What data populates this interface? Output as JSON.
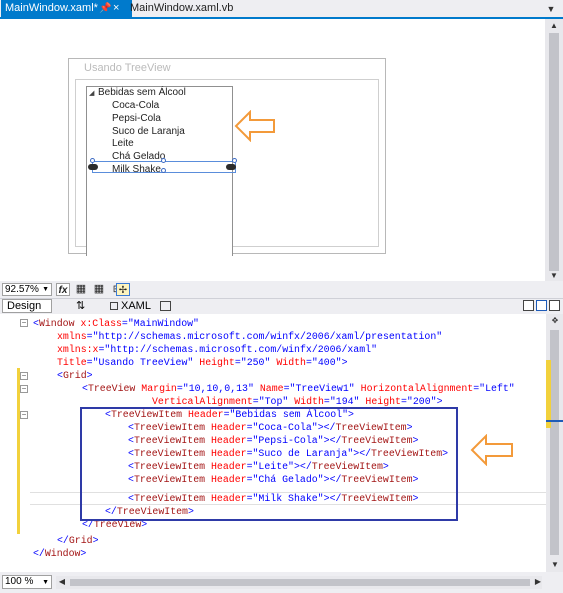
{
  "tabs": [
    {
      "label": "MainWindow.xaml*",
      "active": true
    },
    {
      "label": "MainWindow.xaml.vb",
      "active": false
    }
  ],
  "icons": {
    "pin": "📌",
    "close": "×",
    "dropdown": "▼",
    "fx": "fx",
    "swap": "⇅"
  },
  "designer": {
    "window_title": "Usando TreeView",
    "tree": {
      "root": "Bebidas sem Álcool",
      "expander": "◢",
      "items": [
        "Coca-Cola",
        "Pepsi-Cola",
        "Suco de Laranja",
        "Leite",
        "Chá Gelado",
        "Milk Shake"
      ]
    },
    "zoom": "92.57%"
  },
  "split": {
    "design_label": "Design",
    "xaml_label": "XAML"
  },
  "code": {
    "lines": [
      "<Window x:Class=\"MainWindow\"",
      "xmlns=\"http://schemas.microsoft.com/winfx/2006/xaml/presentation\"",
      "xmlns:x=\"http://schemas.microsoft.com/winfx/2006/xaml\"",
      "Title=\"Usando TreeView\" Height=\"250\" Width=\"400\">",
      "<Grid>",
      "<TreeView Margin=\"10,10,0,13\" Name=\"TreeView1\" HorizontalAlignment=\"Left\"",
      "VerticalAlignment=\"Top\" Width=\"194\" Height=\"200\">",
      "<TreeViewItem Header=\"Bebidas sem Álcool\">",
      "<TreeViewItem Header=\"Coca-Cola\"></TreeViewItem>",
      "<TreeViewItem Header=\"Pepsi-Cola\"></TreeViewItem>",
      "<TreeViewItem Header=\"Suco de Laranja\"></TreeViewItem>",
      "<TreeViewItem Header=\"Leite\"></TreeViewItem>",
      "<TreeViewItem Header=\"Chá Gelado\"></TreeViewItem>",
      "<TreeViewItem Header=\"Milk Shake\"></TreeViewItem>",
      "</TreeViewItem>",
      "</TreeView>",
      "</Grid>",
      "</Window>"
    ]
  },
  "editor_zoom": "100 %",
  "colors": {
    "accent": "#007acc",
    "annotation_arrow": "#f39a3a",
    "highlight_box": "#2e3aa7",
    "change_marker": "#f2d13c"
  }
}
